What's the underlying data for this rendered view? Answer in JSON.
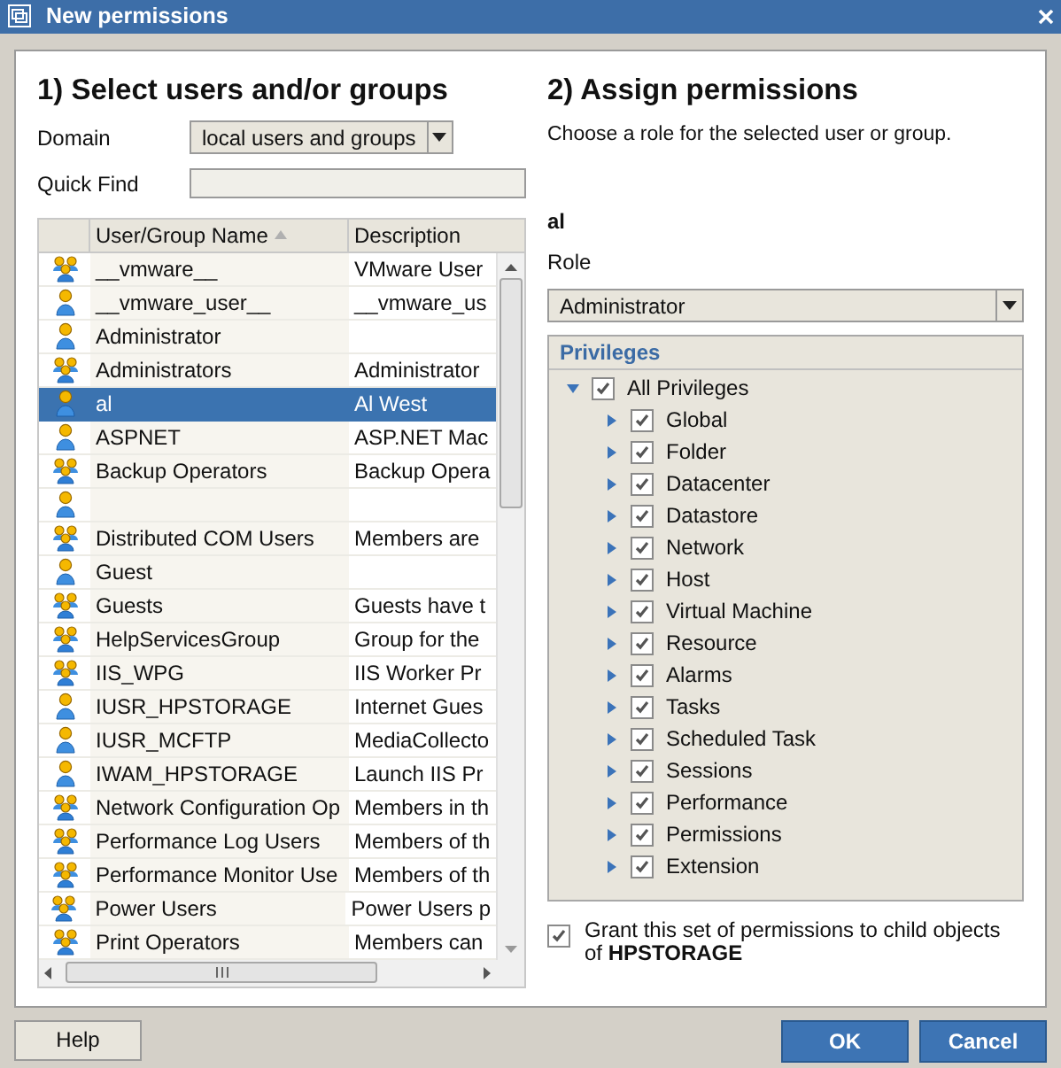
{
  "window": {
    "title": "New permissions"
  },
  "left": {
    "heading": "1) Select users and/or groups",
    "domain_label": "Domain",
    "domain_value": "local users and groups",
    "quick_find_label": "Quick Find",
    "table": {
      "columns": [
        "User/Group Name",
        "Description"
      ],
      "rows": [
        {
          "kind": "group",
          "name": "__vmware__",
          "description": "VMware User",
          "selected": false
        },
        {
          "kind": "user",
          "name": "__vmware_user__",
          "description": "__vmware_us",
          "selected": false
        },
        {
          "kind": "user",
          "name": "Administrator",
          "selected": false
        },
        {
          "kind": "group",
          "name": "Administrators",
          "description": "Administrator",
          "selected": false
        },
        {
          "kind": "user",
          "name": "al",
          "description": "Al West",
          "selected": true
        },
        {
          "kind": "user",
          "name": "ASPNET",
          "description": "ASP.NET Mac",
          "selected": false
        },
        {
          "kind": "group",
          "name": "Backup Operators",
          "description": "Backup Opera",
          "selected": false
        },
        {
          "kind": "user",
          "selected": false
        },
        {
          "kind": "group",
          "name": "Distributed COM Users",
          "description": "Members are",
          "selected": false
        },
        {
          "kind": "user",
          "name": "Guest",
          "selected": false
        },
        {
          "kind": "group",
          "name": "Guests",
          "description": "Guests have t",
          "selected": false
        },
        {
          "kind": "group",
          "name": "HelpServicesGroup",
          "description": "Group for the",
          "selected": false
        },
        {
          "kind": "group",
          "name": "IIS_WPG",
          "description": "IIS Worker Pr",
          "selected": false
        },
        {
          "kind": "user",
          "name": "IUSR_HPSTORAGE",
          "description": "Internet Gues",
          "selected": false
        },
        {
          "kind": "user",
          "name": "IUSR_MCFTP",
          "description": "MediaCollecto",
          "selected": false
        },
        {
          "kind": "user",
          "name": "IWAM_HPSTORAGE",
          "description": "Launch IIS Pr",
          "selected": false
        },
        {
          "kind": "group",
          "name": "Network Configuration Op",
          "description": "Members in th",
          "selected": false
        },
        {
          "kind": "group",
          "name": "Performance Log Users",
          "description": "Members of th",
          "selected": false
        },
        {
          "kind": "group",
          "name": "Performance Monitor Use",
          "description": "Members of th",
          "selected": false
        },
        {
          "kind": "group",
          "name": "Power Users",
          "description": "Power Users p",
          "selected": false
        },
        {
          "kind": "group",
          "name": "Print Operators",
          "description": "Members can",
          "selected": false
        }
      ]
    }
  },
  "right": {
    "heading": "2) Assign permissions",
    "hint": "Choose a role for the selected user or group.",
    "selected_name": "al",
    "role_label": "Role",
    "role_value": "Administrator",
    "privileges": {
      "title": "Privileges",
      "tree": [
        {
          "label": "All Privileges",
          "checked": true,
          "expanded": true,
          "children": [
            {
              "label": "Global",
              "checked": true,
              "expanded": false
            },
            {
              "label": "Folder",
              "checked": true,
              "expanded": false
            },
            {
              "label": "Datacenter",
              "checked": true,
              "expanded": false
            },
            {
              "label": "Datastore",
              "checked": true,
              "expanded": false
            },
            {
              "label": "Network",
              "checked": true,
              "expanded": false
            },
            {
              "label": "Host",
              "checked": true,
              "expanded": false
            },
            {
              "label": "Virtual Machine",
              "checked": true,
              "expanded": false
            },
            {
              "label": "Resource",
              "checked": true,
              "expanded": false
            },
            {
              "label": "Alarms",
              "checked": true,
              "expanded": false
            },
            {
              "label": "Tasks",
              "checked": true,
              "expanded": false
            },
            {
              "label": "Scheduled Task",
              "checked": true,
              "expanded": false
            },
            {
              "label": "Sessions",
              "checked": true,
              "expanded": false
            },
            {
              "label": "Performance",
              "checked": true,
              "expanded": false
            },
            {
              "label": "Permissions",
              "checked": true,
              "expanded": false
            },
            {
              "label": "Extension",
              "checked": true,
              "expanded": false
            }
          ]
        }
      ]
    },
    "propagate": {
      "checked": true,
      "label": "Grant this set of permissions to child objects of **HPSTORAGE**"
    }
  },
  "buttons": {
    "help": "Help",
    "ok": "OK",
    "cancel": "Cancel"
  }
}
